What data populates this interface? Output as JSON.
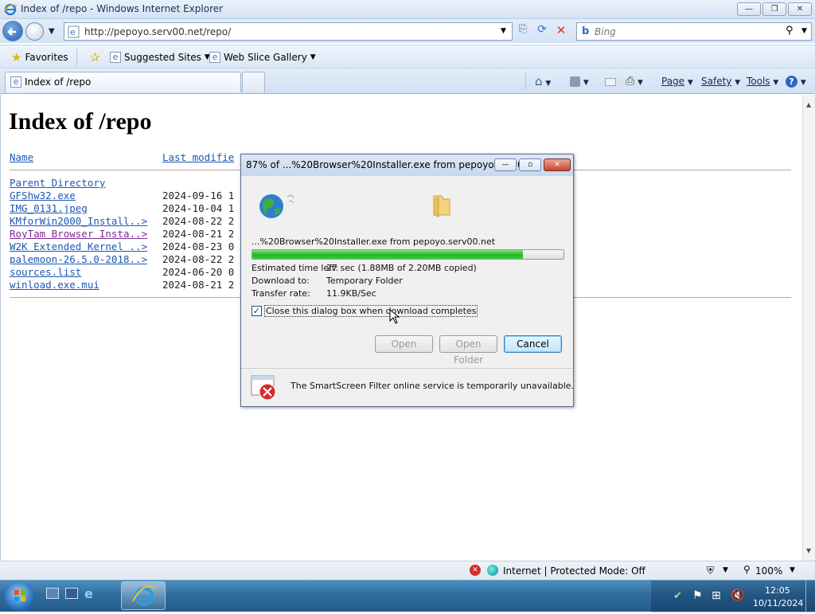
{
  "window": {
    "title": "Index of /repo - Windows Internet Explorer",
    "minimize": "—",
    "restore": "❐",
    "close": "✕"
  },
  "address_bar": {
    "url": "http://pepoyo.serv00.net/repo/",
    "search_placeholder": "Bing"
  },
  "favorites_bar": {
    "favorites_label": "Favorites",
    "suggested_sites": "Suggested Sites",
    "web_slice_gallery": "Web Slice Gallery"
  },
  "tabs": [
    {
      "label": "Index of /repo"
    }
  ],
  "command_bar": {
    "page": "Page",
    "safety": "Safety",
    "tools": "Tools"
  },
  "page": {
    "heading": "Index of /repo",
    "columns": {
      "name": "Name",
      "last_modified": "Last modifie"
    },
    "parent_directory": "Parent Directory",
    "files": [
      {
        "name": "GFShw32.exe",
        "date": "2024-09-16 1"
      },
      {
        "name": "IMG_0131.jpeg",
        "date": "2024-10-04 1"
      },
      {
        "name": "KMforWin2000_Install..>",
        "date": "2024-08-22 2"
      },
      {
        "name": "RoyTam Browser Insta..>",
        "date": "2024-08-21 2",
        "visited": true
      },
      {
        "name": "W2K Extended Kernel ..>",
        "date": "2024-08-23 0"
      },
      {
        "name": "palemoon-26.5.0-2018..>",
        "date": "2024-08-22 2"
      },
      {
        "name": "sources.list",
        "date": "2024-06-20 0"
      },
      {
        "name": "winload.exe.mui",
        "date": "2024-08-21 2"
      }
    ]
  },
  "download_dialog": {
    "title": "87% of ...%20Browser%20Installer.exe from pepoyo.serv0...",
    "file_line": "...%20Browser%20Installer.exe from pepoyo.serv00.net",
    "progress_percent": 87,
    "estimated_label": "Estimated time left:",
    "estimated_value": "27 sec (1.88MB of 2.20MB copied)",
    "download_to_label": "Download to:",
    "download_to_value": "Temporary Folder",
    "transfer_rate_label": "Transfer rate:",
    "transfer_rate_value": "11.9KB/Sec",
    "close_checkbox_label": "Close this dialog box when download completes",
    "close_checkbox_checked": true,
    "open_button": "Open",
    "open_folder_button": "Open Folder",
    "cancel_button": "Cancel",
    "smartscreen_message": "The SmartScreen Filter online service is temporarily unavailable."
  },
  "status_bar": {
    "zone": "Internet | Protected Mode: Off",
    "zoom": "100%"
  },
  "taskbar": {
    "time": "12:05",
    "date": "10/11/2024"
  },
  "colors": {
    "link": "#1c58b5",
    "visited_link": "#7b2a8f",
    "progress": "#22b722"
  }
}
